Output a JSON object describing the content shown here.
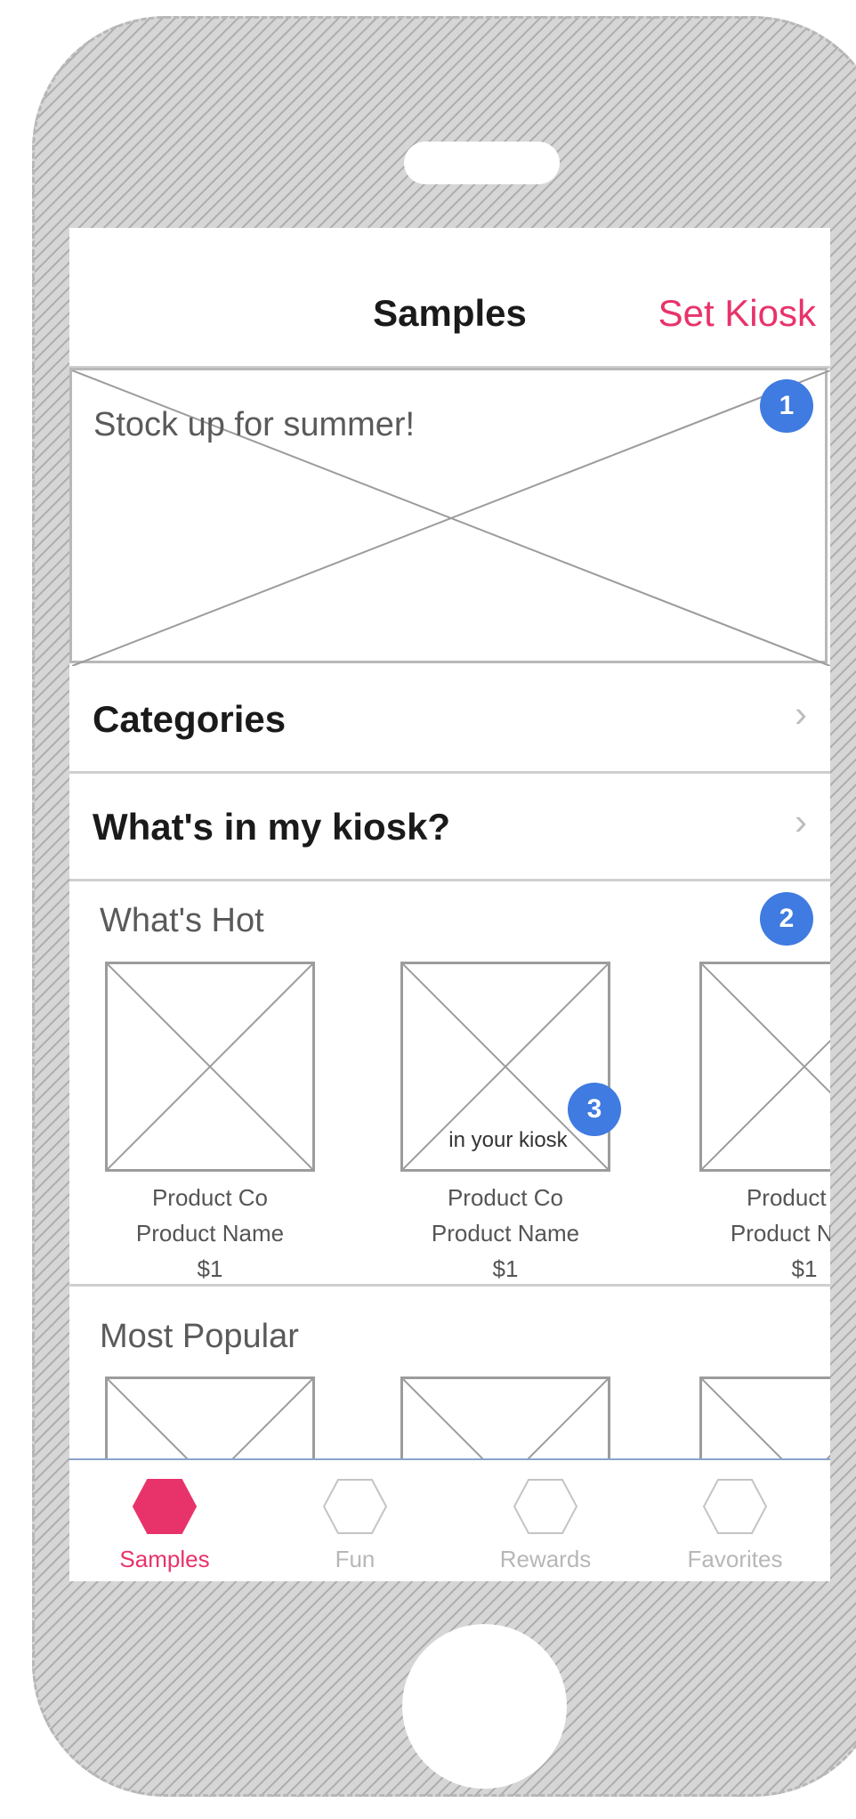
{
  "header": {
    "title": "Samples",
    "action_label": "Set Kiosk"
  },
  "hero": {
    "text": "Stock up for summer!"
  },
  "badges": [
    "1",
    "2",
    "3"
  ],
  "rows": [
    {
      "label": "Categories",
      "chevron": "›"
    },
    {
      "label": "What's in my kiosk?",
      "chevron": "›"
    }
  ],
  "whats_hot": {
    "title": "What's Hot",
    "products": [
      {
        "company": "Product Co",
        "name": "Product Name",
        "price": "$1",
        "tag": ""
      },
      {
        "company": "Product Co",
        "name": "Product Name",
        "price": "$1",
        "tag": "in your kiosk"
      },
      {
        "company": "Product Co",
        "name": "Product Name",
        "price": "$1",
        "tag": ""
      }
    ]
  },
  "most_popular": {
    "title": "Most Popular"
  },
  "tabs": [
    {
      "label": "Samples",
      "icon": "hexagon-filled-icon",
      "active": true
    },
    {
      "label": "Fun",
      "icon": "hexagon-icon",
      "active": false
    },
    {
      "label": "Rewards",
      "icon": "hexagon-icon",
      "active": false
    },
    {
      "label": "Favorites",
      "icon": "hexagon-icon",
      "active": false
    }
  ],
  "colors": {
    "accent": "#e8336a",
    "badge": "#3f7be0",
    "placeholder_line": "#9c9c9c"
  }
}
